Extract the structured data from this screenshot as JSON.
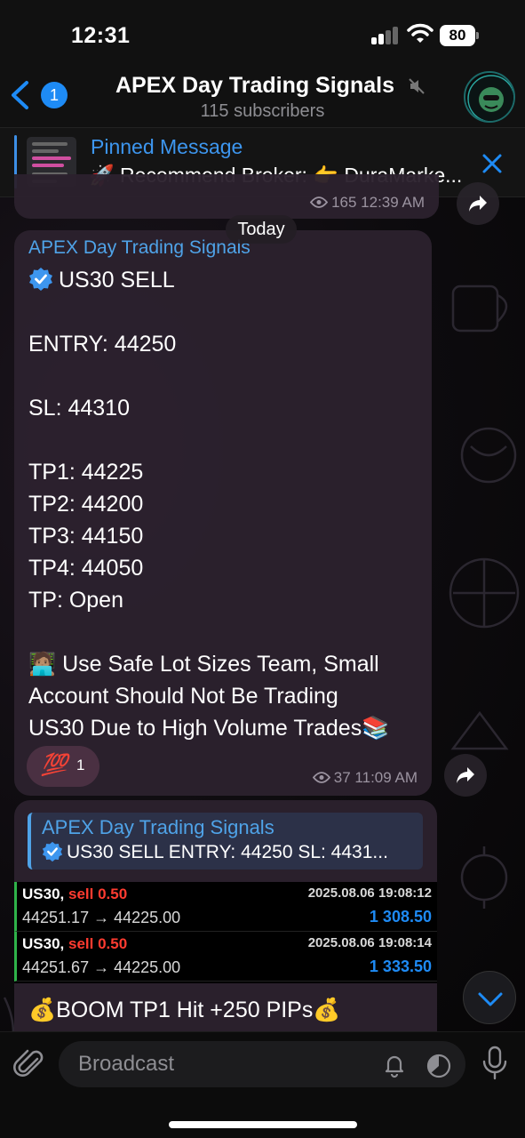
{
  "status_bar": {
    "time": "12:31",
    "battery": "80"
  },
  "header": {
    "back_count": "1",
    "title": "APEX Day Trading Signals",
    "subtitle": "115 subscribers",
    "avatar_icon": "gorilla-logo-icon"
  },
  "pinned": {
    "label": "Pinned Message",
    "text": "🚀 Recommend Broker: 👉 DuraMarke..."
  },
  "previous_message": {
    "views": "165",
    "time": "12:39 AM"
  },
  "date_separator": "Today",
  "message1": {
    "sender": "APEX Day Trading Signals",
    "lines": [
      "US30 SELL",
      "",
      "ENTRY:  44250",
      "",
      "SL:  44310",
      "",
      "TP1:  44225",
      "TP2:  44200",
      "TP3:  44150",
      "TP4:  44050",
      "TP:    Open",
      "",
      "🧑🏽‍💻 Use Safe Lot Sizes Team, Small",
      "Account Should Not Be Trading",
      "US30 Due to High Volume Trades📚"
    ],
    "reaction_emoji": "💯",
    "reaction_count": "1",
    "views": "37",
    "time": "11:09 AM"
  },
  "message2": {
    "reply_name": "APEX Day Trading Signals",
    "reply_text": "US30 SELL ENTRY: 44250 SL: 4431...",
    "trades": [
      {
        "symbol": "US30,",
        "side": "sell 0.50",
        "date": "2025.08.06 19:08:12",
        "prices": "44251.17 → 44225.00",
        "profit": "1 308.50"
      },
      {
        "symbol": "US30,",
        "side": "sell 0.50",
        "date": "2025.08.06 19:08:14",
        "prices": "44251.67 → 44225.00",
        "profit": "1 333.50"
      }
    ],
    "text": "💰BOOM TP1 Hit +250 PIPs💰"
  },
  "input": {
    "placeholder": "Broadcast"
  },
  "colors": {
    "accent": "#1e8bf5",
    "link": "#4fa3e8",
    "sell": "#ff3b30",
    "profit": "#1e8bf5"
  }
}
